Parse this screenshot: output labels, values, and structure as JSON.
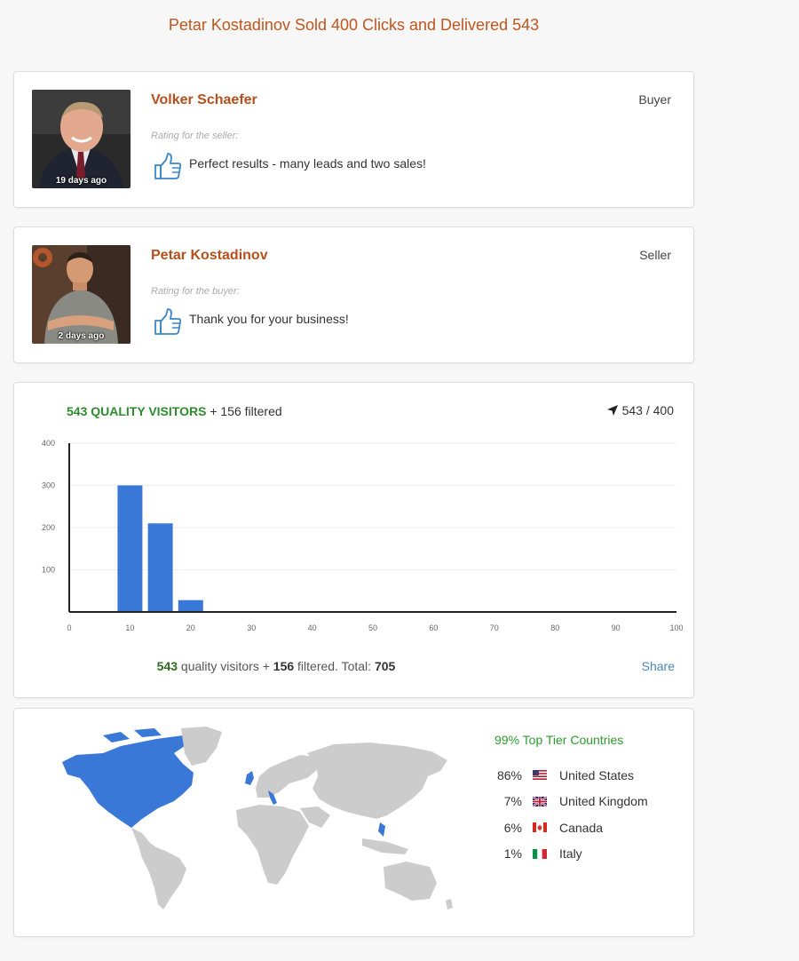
{
  "page": {
    "title": "Petar Kostadinov Sold 400 Clicks and Delivered 543"
  },
  "reviews": [
    {
      "name": "Volker Schaefer",
      "role": "Buyer",
      "age": "19 days ago",
      "rating_label": "Rating for the seller:",
      "comment": "Perfect results - many leads and two sales!"
    },
    {
      "name": "Petar Kostadinov",
      "role": "Seller",
      "age": "2 days ago",
      "rating_label": "Rating for the buyer:",
      "comment": "Thank you for your business!"
    }
  ],
  "traffic": {
    "quality_label": "543 QUALITY VISITORS",
    "filtered_label": "+ 156 filtered",
    "ratio": "543 / 400",
    "summary": {
      "quality": "543",
      "quality_text": "quality visitors +",
      "filtered": "156",
      "filtered_text": "filtered. Total:",
      "total": "705"
    },
    "share_label": "Share"
  },
  "chart_data": {
    "type": "bar",
    "x": [
      10,
      15,
      20
    ],
    "values": [
      300,
      210,
      28
    ],
    "xlim": [
      0,
      100
    ],
    "ylim": [
      0,
      400
    ],
    "xticks": [
      "0",
      "10",
      "20",
      "30",
      "40",
      "50",
      "60",
      "70",
      "80",
      "90",
      "100"
    ],
    "yticks": [
      "100",
      "200",
      "300",
      "400"
    ],
    "bar_color": "#3a78d8",
    "grid": true
  },
  "countries": {
    "headline": "99% Top Tier Countries",
    "items": [
      {
        "pct": "86%",
        "name": "United States",
        "flag": "us-flag"
      },
      {
        "pct": "7%",
        "name": "United Kingdom",
        "flag": "uk-flag"
      },
      {
        "pct": "6%",
        "name": "Canada",
        "flag": "ca-flag"
      },
      {
        "pct": "1%",
        "name": "Italy",
        "flag": "it-flag"
      }
    ],
    "highlight_color": "#3a78d8",
    "base_color": "#cccccc"
  },
  "colors": {
    "accent": "#c0561f",
    "green": "#2e8b2e",
    "link": "#4a86b8"
  }
}
